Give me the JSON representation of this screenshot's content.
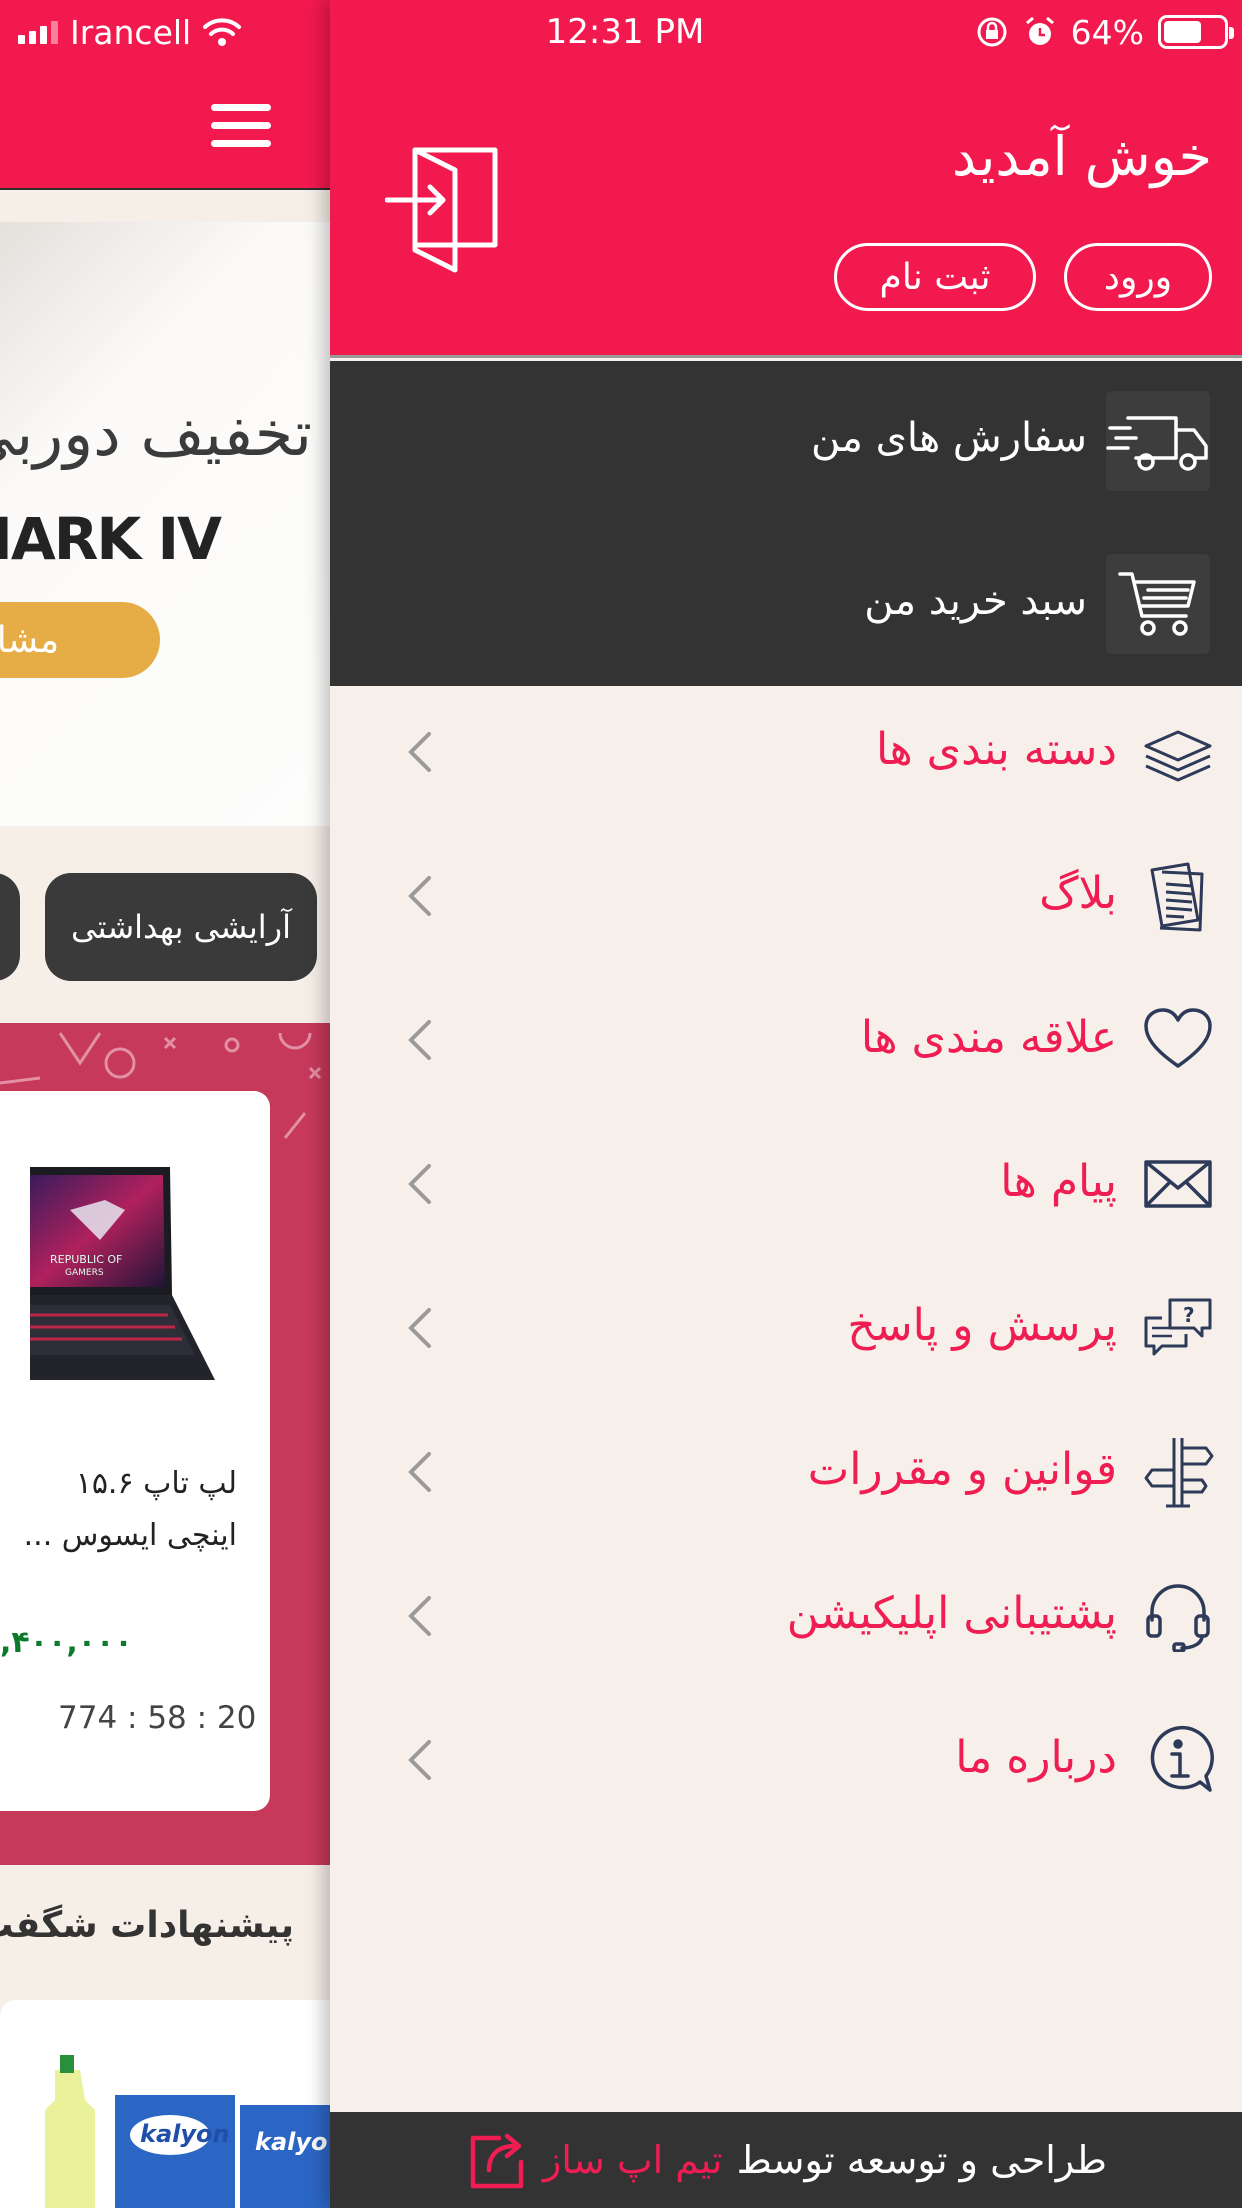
{
  "status_bar": {
    "carrier": "Irancell",
    "time": "12:31 PM",
    "battery": "64%",
    "battery_level": 0.64
  },
  "background_app": {
    "banner": {
      "title": "تخفیف دوربی",
      "model": "MARK IV",
      "button": "مشاهده"
    },
    "categories": [
      "آرایشی بهداشتی"
    ],
    "product": {
      "name": "لپ تاپ ۱۵.۶ اینچی ایسوس ...",
      "price": ",۴۰۰,۰۰۰",
      "timer": "774 : 58 : 20"
    },
    "section_title": "پیشنهادات شگفت"
  },
  "drawer": {
    "header": {
      "welcome": "خوش آمدید",
      "login": "ورود",
      "register": "ثبت نام"
    },
    "dark_items": [
      {
        "label": "سفارش های من",
        "icon": "truck-icon"
      },
      {
        "label": "سبد خرید من",
        "icon": "cart-icon"
      }
    ],
    "menu": [
      {
        "label": "دسته بندی ها",
        "icon": "layers-icon"
      },
      {
        "label": "بلاگ",
        "icon": "document-icon"
      },
      {
        "label": "علاقه مندی ها",
        "icon": "heart-icon"
      },
      {
        "label": "پیام ها",
        "icon": "envelope-icon"
      },
      {
        "label": "پرسش و پاسخ",
        "icon": "question-bubble-icon"
      },
      {
        "label": "قوانین و مقررات",
        "icon": "signpost-icon"
      },
      {
        "label": "پشتیبانی اپلیکیشن",
        "icon": "headset-icon"
      },
      {
        "label": "درباره ما",
        "icon": "info-bubble-icon"
      }
    ],
    "footer": {
      "text": "طراحی و توسعه توسط",
      "brand": "تیم اپ ساز"
    }
  },
  "colors": {
    "accent": "#f2194f",
    "menu_text": "#ef1d52",
    "dark": "#333333",
    "drawer_bg": "#f7f0ea",
    "promo_bg": "#c6395b",
    "price_green": "#0b7a2d"
  }
}
